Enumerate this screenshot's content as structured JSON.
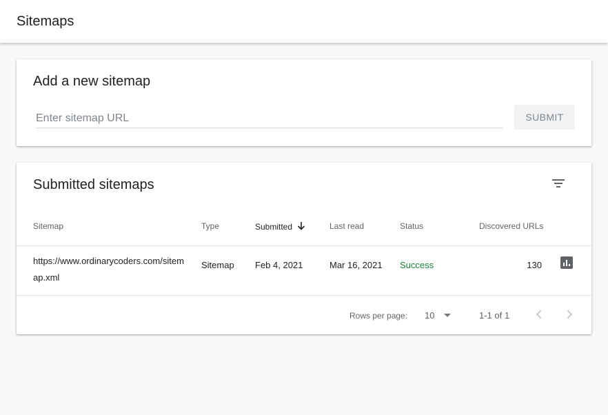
{
  "header": {
    "title": "Sitemaps"
  },
  "add_card": {
    "title": "Add a new sitemap",
    "input_placeholder": "Enter sitemap URL",
    "input_value": "",
    "submit_label": "SUBMIT"
  },
  "list_card": {
    "title": "Submitted sitemaps",
    "filter_icon": "filter-list-icon",
    "columns": {
      "sitemap": "Sitemap",
      "type": "Type",
      "submitted": "Submitted",
      "last_read": "Last read",
      "status": "Status",
      "discovered": "Discovered URLs"
    },
    "sort": {
      "column": "submitted",
      "direction": "descending",
      "icon": "arrow-down-icon"
    },
    "rows": [
      {
        "sitemap": "https://www.ordinarycoders.com/sitemap.xml",
        "type": "Sitemap",
        "submitted": "Feb 4, 2021",
        "last_read": "Mar 16, 2021",
        "status": "Success",
        "discovered": "130",
        "action_icon": "bar-chart-icon"
      }
    ],
    "pagination": {
      "rows_per_page_label": "Rows per page:",
      "rows_per_page": "10",
      "range": "1-1 of 1"
    }
  },
  "colors": {
    "status_success": "#188038",
    "icon_gray": "#5f6368",
    "background": "#f8f8f8"
  }
}
